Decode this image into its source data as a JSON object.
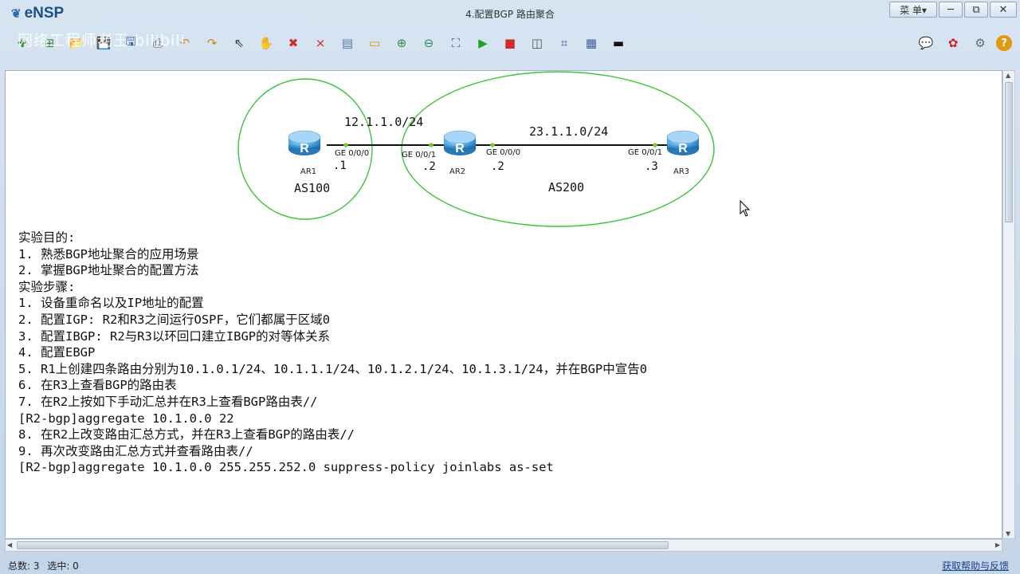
{
  "app": {
    "name": "eNSP",
    "window_title": "4.配置BGP 路由聚合",
    "menu_label": "菜 单▾"
  },
  "window_controls": {
    "minimize": "─",
    "restore": "⧉",
    "close": "✕"
  },
  "watermark": "网络工程师老王 bilibili",
  "toolbar": {
    "left_icons": [
      {
        "name": "new-topology-icon",
        "glyph": "✚",
        "color": "#3a8a3a"
      },
      {
        "name": "new-lab-icon",
        "glyph": "⊞",
        "color": "#3a8a3a"
      },
      {
        "name": "open-icon",
        "glyph": "📂",
        "color": "#c98a1a"
      },
      {
        "name": "save-icon",
        "glyph": "💾",
        "color": "#3b5f9a"
      },
      {
        "name": "save-as-icon",
        "glyph": "🖫",
        "color": "#3b5f9a"
      },
      {
        "name": "print-icon",
        "glyph": "⎙",
        "color": "#555555"
      },
      {
        "name": "undo-icon",
        "glyph": "↶",
        "color": "#c98a1a"
      },
      {
        "name": "redo-icon",
        "glyph": "↷",
        "color": "#c98a1a"
      },
      {
        "name": "select-pointer-icon",
        "glyph": "⇖",
        "color": "#333333"
      },
      {
        "name": "hand-pan-icon",
        "glyph": "✋",
        "color": "#c98a1a"
      },
      {
        "name": "delete-icon",
        "glyph": "✖",
        "color": "#d02a2a"
      },
      {
        "name": "delete-link-icon",
        "glyph": "⨯",
        "color": "#d02a2a"
      },
      {
        "name": "text-note-icon",
        "glyph": "▤",
        "color": "#5577aa"
      },
      {
        "name": "rectangle-icon",
        "glyph": "▭",
        "color": "#c89a10"
      },
      {
        "name": "zoom-in-icon",
        "glyph": "⊕",
        "color": "#2e8b57"
      },
      {
        "name": "zoom-out-icon",
        "glyph": "⊖",
        "color": "#2e8b57"
      },
      {
        "name": "fit-view-icon",
        "glyph": "⛶",
        "color": "#3b5f9a"
      },
      {
        "name": "start-device-icon",
        "glyph": "▶",
        "color": "#22a022"
      },
      {
        "name": "stop-device-icon",
        "glyph": "■",
        "color": "#d02a2a"
      },
      {
        "name": "capture-icon",
        "glyph": "◫",
        "color": "#555555"
      },
      {
        "name": "topology-icon",
        "glyph": "⌗",
        "color": "#3b5f9a"
      },
      {
        "name": "grid-icon",
        "glyph": "▦",
        "color": "#3b5f9a"
      },
      {
        "name": "cli-icon",
        "glyph": "▬",
        "color": "#111111"
      }
    ],
    "right_icons": [
      {
        "name": "chat-icon",
        "glyph": "💬",
        "color": "#3b5f9a"
      },
      {
        "name": "huawei-logo-icon",
        "glyph": "✿",
        "color": "#d0202a"
      },
      {
        "name": "settings-gear-icon",
        "glyph": "⚙",
        "color": "#6a6a6a"
      },
      {
        "name": "help-icon",
        "glyph": "?",
        "color": "#e09a10"
      }
    ]
  },
  "topology": {
    "subnet_1": "12.1.1.0/24",
    "subnet_2": "23.1.1.0/24",
    "as_left": "AS100",
    "as_right": "AS200",
    "routers": [
      {
        "label": "AR1",
        "interfaces": [
          {
            "name": "GE 0/0/0",
            "ip_suffix": ".1"
          }
        ]
      },
      {
        "label": "AR2",
        "interfaces": [
          {
            "name": "GE 0/0/1",
            "ip_suffix": ".2"
          },
          {
            "name": "GE 0/0/0",
            "ip_suffix": ".2"
          }
        ]
      },
      {
        "label": "AR3",
        "interfaces": [
          {
            "name": "GE 0/0/1",
            "ip_suffix": ".3"
          }
        ]
      }
    ],
    "router_glyph": "R",
    "colors": {
      "as_circle": "#3ec43e",
      "link": "#111111",
      "port_dot": "#7acb36",
      "router": "#3f97d6"
    }
  },
  "notes": [
    "实验目的:",
    "1. 熟悉BGP地址聚合的应用场景",
    "2. 掌握BGP地址聚合的配置方法",
    "实验步骤:",
    "1. 设备重命名以及IP地址的配置",
    "2. 配置IGP: R2和R3之间运行OSPF，它们都属于区域0",
    "3. 配置IBGP: R2与R3以环回口建立IBGP的对等体关系",
    "4. 配置EBGP",
    "5. R1上创建四条路由分别为10.1.0.1/24、10.1.1.1/24、10.1.2.1/24、10.1.3.1/24，并在BGP中宣告0",
    "6. 在R3上查看BGP的路由表",
    "7. 在R2上按如下手动汇总并在R3上查看BGP路由表//",
    "[R2-bgp]aggregate 10.1.0.0 22",
    "8. 在R2上改变路由汇总方式，并在R3上查看BGP的路由表//",
    "9. 再次改变路由汇总方式并查看路由表//",
    "[R2-bgp]aggregate 10.1.0.0 255.255.252.0 suppress-policy joinlabs as-set"
  ],
  "status": {
    "total_label": "总数: 3",
    "selected_label": "选中: 0",
    "help_link": "获取帮助与反馈"
  },
  "scroll": {
    "up": "▲",
    "down": "▼",
    "left": "◀",
    "right": "▶"
  }
}
